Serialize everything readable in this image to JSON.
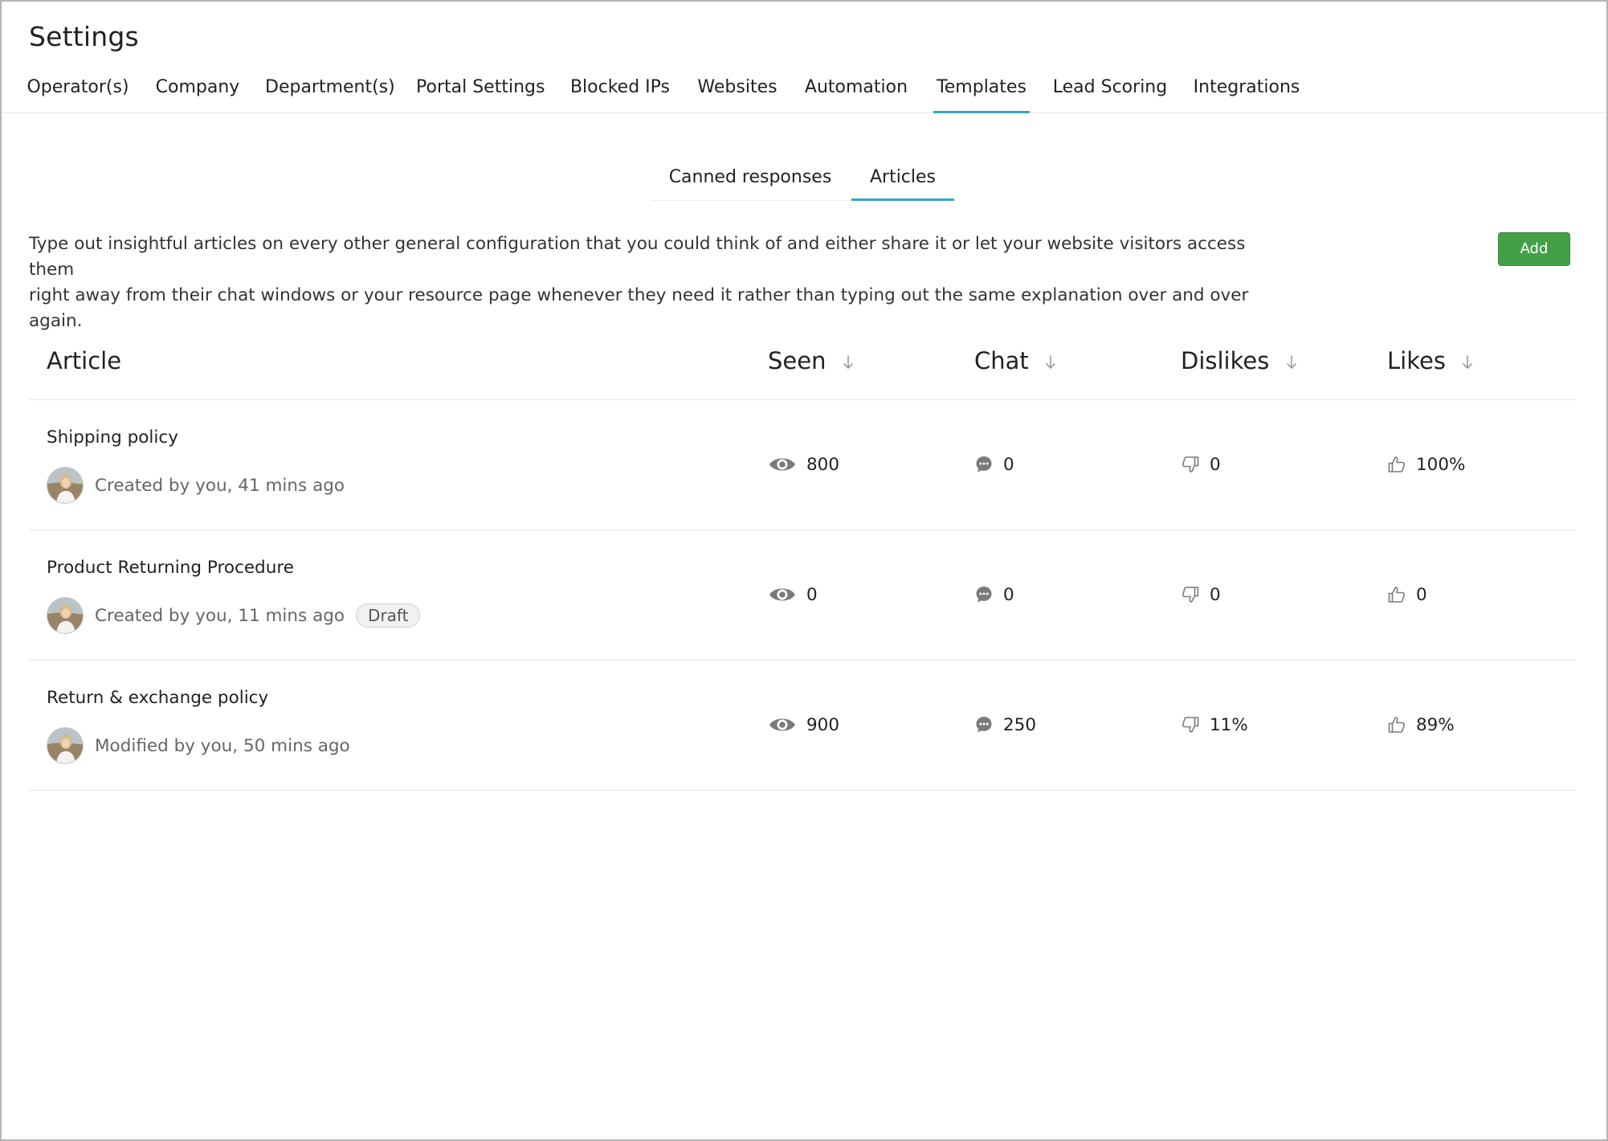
{
  "page": {
    "title": "Settings"
  },
  "main_tabs": [
    {
      "label": "Operator(s)"
    },
    {
      "label": "Company"
    },
    {
      "label": "Department(s)"
    },
    {
      "label": "Portal Settings"
    },
    {
      "label": "Blocked IPs"
    },
    {
      "label": "Websites"
    },
    {
      "label": "Automation"
    },
    {
      "label": "Templates",
      "active": true
    },
    {
      "label": "Lead Scoring"
    },
    {
      "label": "Integrations"
    }
  ],
  "sub_tabs": [
    {
      "label": "Canned responses"
    },
    {
      "label": "Articles",
      "active": true
    }
  ],
  "description": {
    "line1": "Type out insightful articles on every other general configuration that you could think of and either share it or let your website visitors access them",
    "line2": "right away from their chat windows or your resource page whenever they need it rather than typing out the same explanation over and over again."
  },
  "add_button": {
    "label": "Add"
  },
  "table": {
    "columns": {
      "article": "Article",
      "seen": "Seen",
      "chat": "Chat",
      "dislikes": "Dislikes",
      "likes": "Likes"
    },
    "rows": [
      {
        "title": "Shipping policy",
        "meta": "Created by you, 41 mins ago",
        "badge": "",
        "seen": "800",
        "chat": "0",
        "dislikes": "0",
        "likes": "100%"
      },
      {
        "title": "Product Returning Procedure",
        "meta": "Created by you, 11 mins ago",
        "badge": "Draft",
        "seen": "0",
        "chat": "0",
        "dislikes": "0",
        "likes": "0"
      },
      {
        "title": "Return & exchange policy",
        "meta": "Modified by you, 50 mins ago",
        "badge": "",
        "seen": "900",
        "chat": "250",
        "dislikes": "11%",
        "likes": "89%"
      }
    ]
  },
  "icons": {
    "seen": "eye-icon",
    "chat": "chat-bubble-icon",
    "dislikes": "thumbs-down-icon",
    "likes": "thumbs-up-icon",
    "sort": "sort-arrow-down-icon"
  },
  "colors": {
    "accent": "#38a6c4",
    "add_button": "#43a047",
    "icon": "#7a7a7a"
  }
}
